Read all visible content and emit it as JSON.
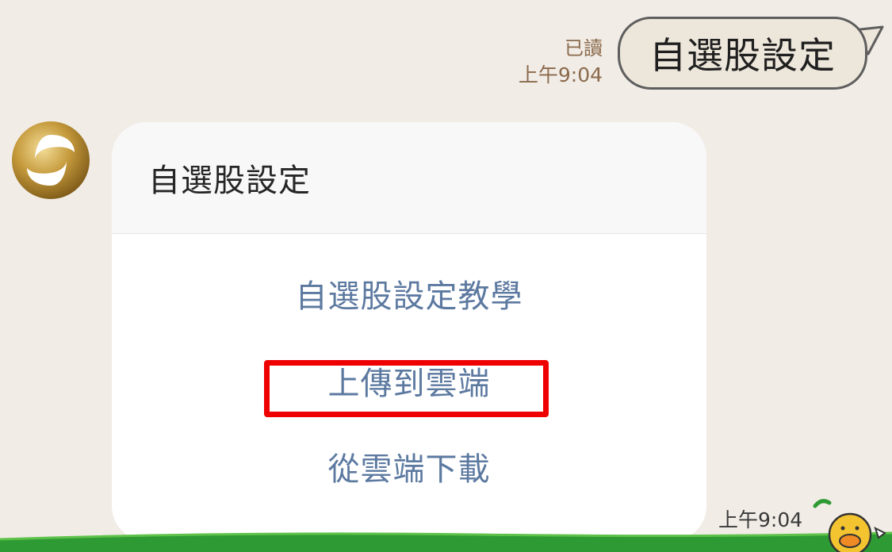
{
  "outgoing": {
    "read_status": "已讀",
    "time": "上午9:04",
    "text": "自選股設定"
  },
  "incoming": {
    "avatar_icon": "bank-logo-icon",
    "card": {
      "title": "自選股設定",
      "actions": [
        {
          "label": "自選股設定教學"
        },
        {
          "label": "上傳到雲端",
          "highlighted": true
        },
        {
          "label": "從雲端下載"
        }
      ]
    },
    "time": "上午9:04"
  },
  "colors": {
    "background": "#f1ece6",
    "action_link": "#5c79a0",
    "highlight": "#ee0000",
    "ground": "#2e9a33",
    "meta_text": "#8b6a4c"
  },
  "decor": {
    "sticker_icon": "chick-sticker-icon"
  }
}
